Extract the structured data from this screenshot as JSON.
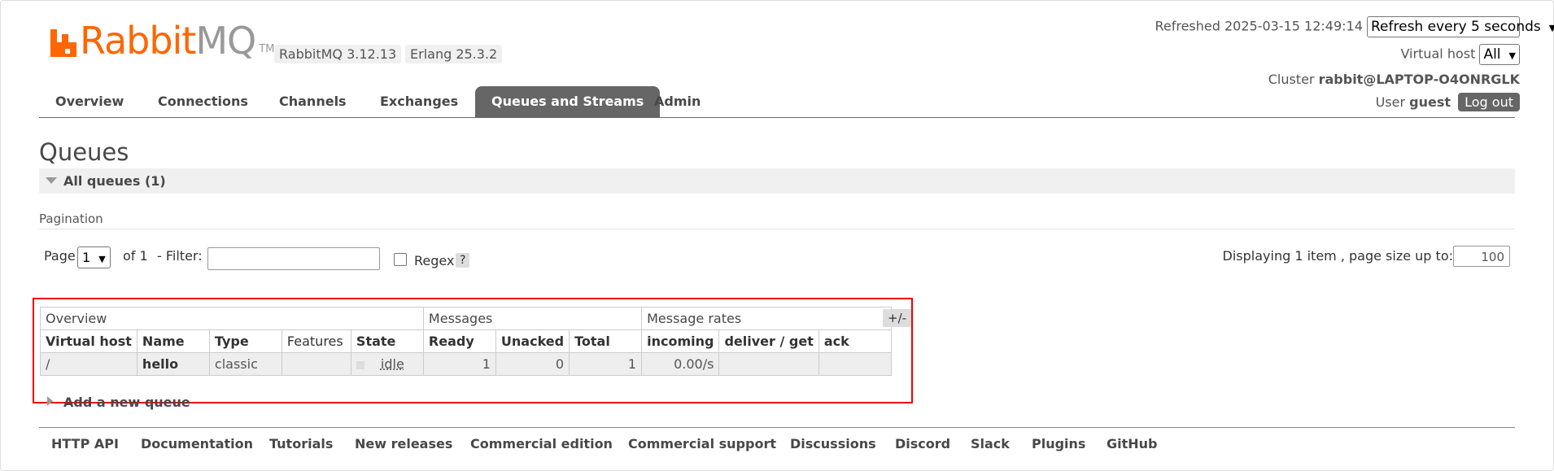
{
  "logo": {
    "brand_orange": "Rabbit",
    "brand_grey": "MQ",
    "tm": "TM"
  },
  "versions": {
    "rabbitmq": "RabbitMQ 3.12.13",
    "erlang": "Erlang 25.3.2"
  },
  "header": {
    "refreshed_label": "Refreshed 2025-03-15 12:49:14",
    "refresh_select": "Refresh every 5 seconds",
    "vhost_label": "Virtual host",
    "vhost_select": "All",
    "cluster_label": "Cluster",
    "cluster_value": "rabbit@LAPTOP-O4ONRGLK",
    "user_label": "User",
    "user_value": "guest",
    "logout": "Log out"
  },
  "tabs": [
    {
      "label": "Overview"
    },
    {
      "label": "Connections"
    },
    {
      "label": "Channels"
    },
    {
      "label": "Exchanges"
    },
    {
      "label": "Queues and Streams",
      "active": true
    },
    {
      "label": "Admin"
    }
  ],
  "page_title": "Queues",
  "section": {
    "label": "All queues (1)"
  },
  "pagination": {
    "heading": "Pagination",
    "page_label": "Page",
    "page_value": "1",
    "of_label": "of 1",
    "filter_label": "- Filter:",
    "filter_value": "",
    "regex_label": "Regex",
    "help": "?",
    "displaying": "Displaying 1 item , page size up to:",
    "page_size": "100"
  },
  "table": {
    "groups": [
      "Overview",
      "Messages",
      "Message rates"
    ],
    "columns": [
      "Virtual host",
      "Name",
      "Type",
      "Features",
      "State",
      "Ready",
      "Unacked",
      "Total",
      "incoming",
      "deliver / get",
      "ack"
    ],
    "rows": [
      {
        "vhost": "/",
        "name": "hello",
        "type": "classic",
        "features": "",
        "state": "idle",
        "ready": "1",
        "unacked": "0",
        "total": "1",
        "incoming": "0.00/s",
        "deliver_get": "",
        "ack": ""
      }
    ],
    "toggle": "+/-"
  },
  "add_queue": "Add a new queue",
  "footer": [
    "HTTP API",
    "Documentation",
    "Tutorials",
    "New releases",
    "Commercial edition",
    "Commercial support",
    "Discussions",
    "Discord",
    "Slack",
    "Plugins",
    "GitHub"
  ],
  "colors": {
    "brand": "#ff6600",
    "tab_active": "#666666",
    "highlight": "#e00000"
  }
}
